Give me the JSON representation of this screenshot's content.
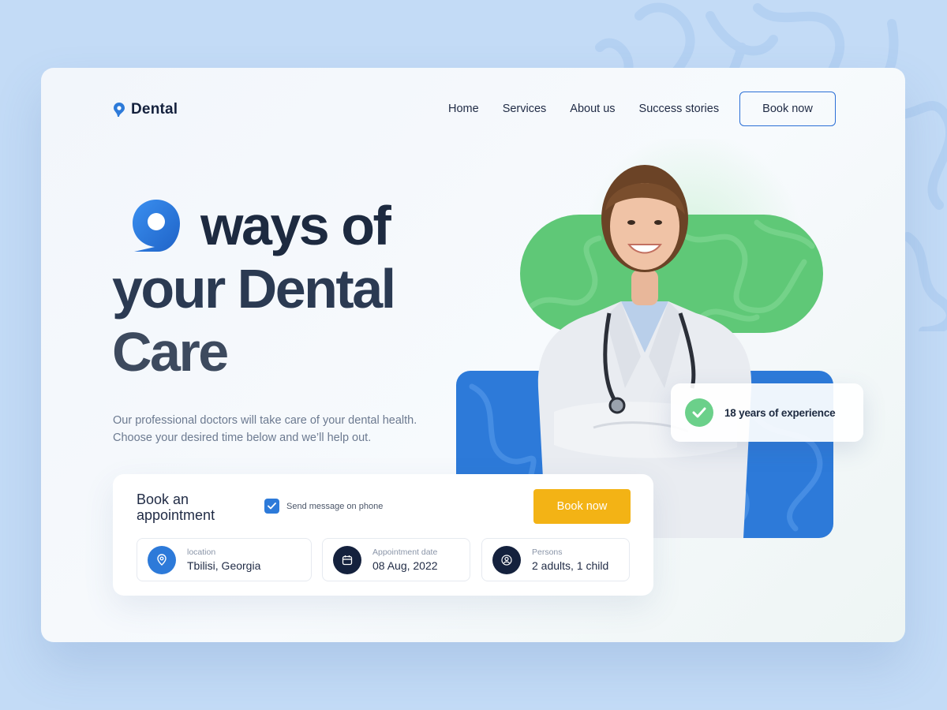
{
  "brand": {
    "name": "Dental"
  },
  "nav": {
    "items": [
      "Home",
      "Services",
      "About us",
      "Success stories"
    ],
    "cta": "Book now"
  },
  "hero": {
    "number": "9",
    "line1": "ways of",
    "line2": "your Dental",
    "line3": "Care",
    "subtitle": "Our professional doctors will take care of your dental health. Choose your desired time below and we’ll help out."
  },
  "badge": {
    "text": "18 years of experience"
  },
  "booking": {
    "title": "Book an appointment",
    "sms_label": "Send message on phone",
    "sms_checked": true,
    "cta": "Book now",
    "fields": [
      {
        "label": "location",
        "value": "Tbilisi, Georgia",
        "icon": "location-pin-icon"
      },
      {
        "label": "Appointment date",
        "value": "08 Aug, 2022",
        "icon": "calendar-icon"
      },
      {
        "label": "Persons",
        "value": "2 adults, 1 child",
        "icon": "user-icon"
      }
    ]
  },
  "colors": {
    "accent_blue": "#2d7ad9",
    "accent_green": "#5fc877",
    "accent_yellow": "#f3b315",
    "text_dark": "#14213d",
    "page_bg": "#c3dbf6"
  }
}
